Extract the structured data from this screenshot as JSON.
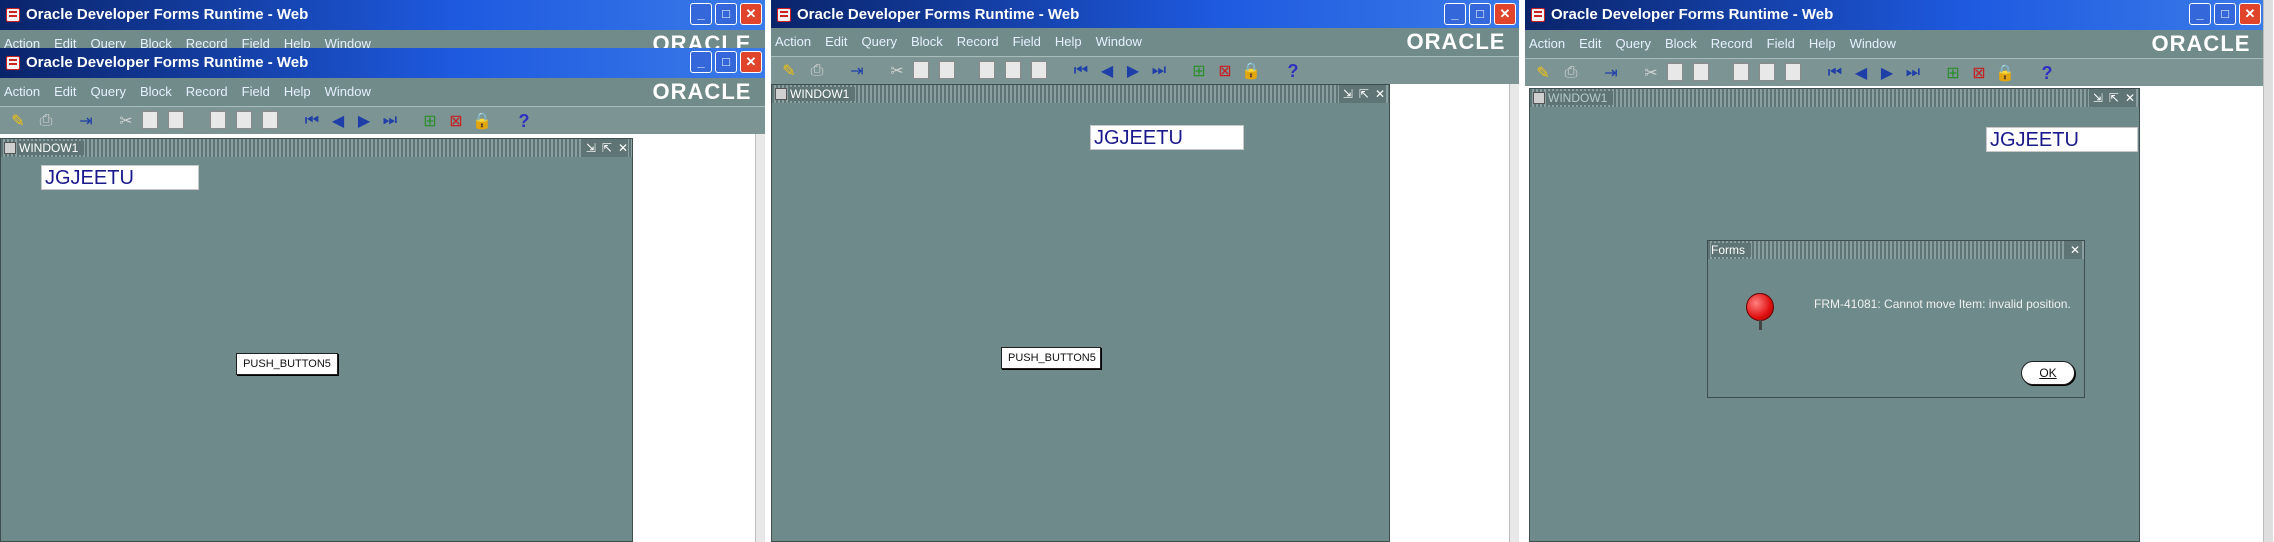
{
  "panel1": {
    "back_title": "Oracle Developer Forms Runtime - Web",
    "back_menu": [
      "Action",
      "Edit",
      "Query",
      "Block",
      "Record",
      "Field",
      "Help",
      "Window"
    ],
    "back_logo": "ORACLE",
    "title": "Oracle Developer Forms Runtime - Web",
    "menu": [
      "Action",
      "Edit",
      "Query",
      "Block",
      "Record",
      "Field",
      "Help",
      "Window"
    ],
    "logo": "ORACLE",
    "window_title": "WINDOW1",
    "text_item": "JGJEETU",
    "push_button": "PUSH_BUTTON5"
  },
  "panel2": {
    "title": "Oracle Developer Forms Runtime - Web",
    "menu": [
      "Action",
      "Edit",
      "Query",
      "Block",
      "Record",
      "Field",
      "Help",
      "Window"
    ],
    "logo": "ORACLE",
    "window_title": "WINDOW1",
    "text_item": "JGJEETU",
    "push_button": "PUSH_BUTTON5"
  },
  "panel3": {
    "title": "Oracle Developer Forms Runtime - Web",
    "menu": [
      "Action",
      "Edit",
      "Query",
      "Block",
      "Record",
      "Field",
      "Help",
      "Window"
    ],
    "logo": "ORACLE",
    "window_title": "WINDOW1",
    "text_item": "JGJEETU",
    "alert": {
      "title": "Forms",
      "message": "FRM-41081: Cannot move Item: invalid position.",
      "ok_label": "OK"
    }
  },
  "window_buttons": {
    "minimize": "_",
    "maximize": "□",
    "close": "✕"
  },
  "mdi_buttons": {
    "minimize": "⇲",
    "maximize": "⇱",
    "close": "✕"
  },
  "toolbar_icons": [
    "save-icon",
    "print-icon",
    "exit-icon",
    "cut-icon",
    "copy-icon",
    "paste-icon",
    "enter-query-icon",
    "execute-query-icon",
    "cancel-query-icon",
    "previous-block-icon",
    "previous-record-icon",
    "next-record-icon",
    "next-block-icon",
    "insert-record-icon",
    "delete-record-icon",
    "lock-record-icon",
    "help-icon"
  ],
  "colors": {
    "canvas": "#6f8a8a",
    "titlebar": "#0a246a",
    "menubar": "#718b8b",
    "text_item_fg": "#1a1a8a"
  }
}
